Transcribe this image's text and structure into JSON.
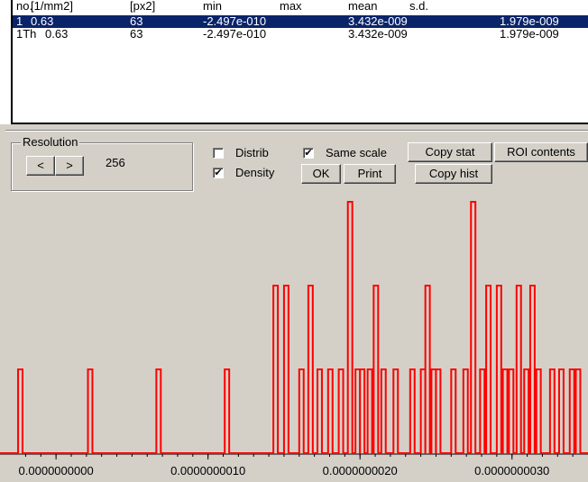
{
  "stats_table": {
    "headers": [
      "no.",
      "[1/mm2]",
      "[px2]",
      "min",
      "max",
      "mean",
      "s.d."
    ],
    "rows": [
      {
        "no": "1",
        "per_mm2": "0.63",
        "px2": "63",
        "min": "-2.497e-010",
        "mean": "3.432e-009",
        "sd": "1.979e-009",
        "selected": true
      },
      {
        "no": "1Th",
        "per_mm2": "0.63",
        "px2": "63",
        "min": "-2.497e-010",
        "mean": "3.432e-009",
        "sd": "1.979e-009",
        "selected": false
      }
    ]
  },
  "controls": {
    "resolution": {
      "title": "Resolution",
      "prev_label": "<",
      "next_label": ">",
      "value": "256"
    },
    "distrib": {
      "label": "Distrib",
      "checked": false
    },
    "density": {
      "label": "Density",
      "checked": true
    },
    "same_scale": {
      "label": "Same scale",
      "checked": true
    },
    "ok_label": "OK",
    "print_label": "Print",
    "copy_stat_label": "Copy stat",
    "copy_hist_label": "Copy hist",
    "roi_contents_label": "ROI contents"
  },
  "chart_data": {
    "type": "bar",
    "series_color": "#ff0000",
    "x_tick_labels": [
      "0.0000000000",
      "0.0000000010",
      "0.0000000020",
      "0.0000000030"
    ],
    "x_ticks": [
      0.0,
      1e-09,
      2e-09,
      3e-09
    ],
    "xlim": [
      -2.5e-10,
      3.5e-09
    ],
    "ylim": [
      0,
      3
    ],
    "bins": [
      [
        -2.497e-10,
        1
      ],
      [
        2.1e-10,
        1
      ],
      [
        6.6e-10,
        1
      ],
      [
        1.11e-09,
        1
      ],
      [
        1.43e-09,
        2
      ],
      [
        1.5e-09,
        2
      ],
      [
        1.6e-09,
        1
      ],
      [
        1.66e-09,
        2
      ],
      [
        1.72e-09,
        1
      ],
      [
        1.79e-09,
        1
      ],
      [
        1.86e-09,
        1
      ],
      [
        1.92e-09,
        3
      ],
      [
        1.97e-09,
        1
      ],
      [
        2e-09,
        1
      ],
      [
        2.05e-09,
        1
      ],
      [
        2.09e-09,
        2
      ],
      [
        2.14e-09,
        1
      ],
      [
        2.22e-09,
        1
      ],
      [
        2.33e-09,
        1
      ],
      [
        2.4e-09,
        1
      ],
      [
        2.43e-09,
        2
      ],
      [
        2.47e-09,
        1
      ],
      [
        2.5e-09,
        1
      ],
      [
        2.6e-09,
        1
      ],
      [
        2.68e-09,
        1
      ],
      [
        2.73e-09,
        3
      ],
      [
        2.79e-09,
        1
      ],
      [
        2.83e-09,
        2
      ],
      [
        2.9e-09,
        2
      ],
      [
        2.94e-09,
        1
      ],
      [
        2.98e-09,
        1
      ],
      [
        3.03e-09,
        2
      ],
      [
        3.08e-09,
        1
      ],
      [
        3.12e-09,
        2
      ],
      [
        3.16e-09,
        1
      ],
      [
        3.25e-09,
        1
      ],
      [
        3.31e-09,
        1
      ],
      [
        3.38e-09,
        1
      ],
      [
        3.42e-09,
        1
      ]
    ]
  }
}
